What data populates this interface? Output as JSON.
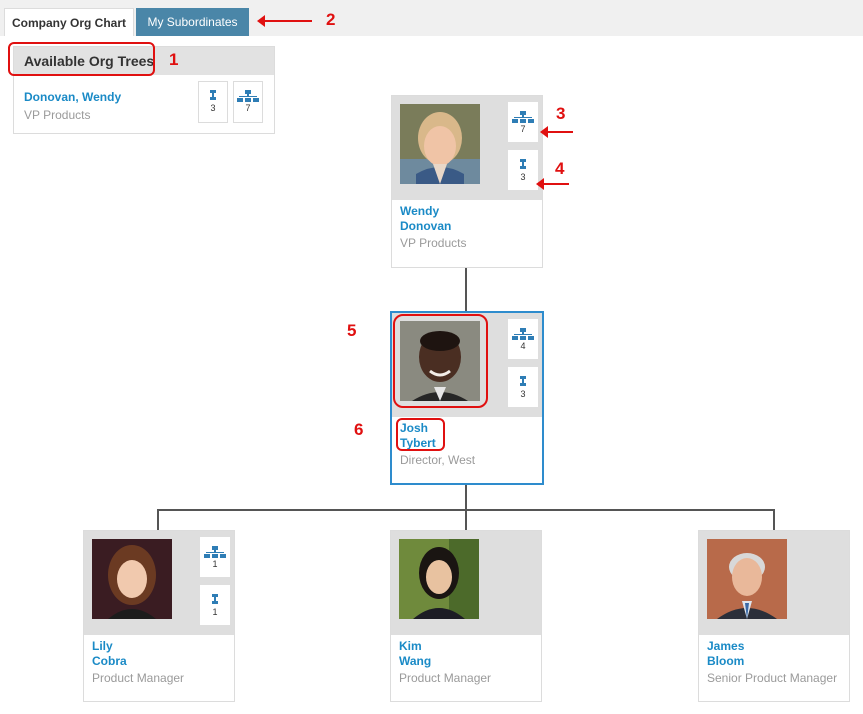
{
  "tabs": {
    "active": "Company Org Chart",
    "inactive": "My Subordinates"
  },
  "available": {
    "header": "Available Org Trees",
    "name": "Donovan, Wendy",
    "title": "VP Products",
    "direct_count": "3",
    "tree_count": "7"
  },
  "annotations": [
    "1",
    "2",
    "3",
    "4",
    "5",
    "6"
  ],
  "root": {
    "first": "Wendy",
    "last": "Donovan",
    "title": "VP Products",
    "tree_count": "7",
    "direct_count": "3"
  },
  "selected": {
    "first": "Josh",
    "last": "Tybert",
    "title": "Director, West",
    "tree_count": "4",
    "direct_count": "3"
  },
  "children": [
    {
      "first": "Lily",
      "last": "Cobra",
      "title": "Product Manager",
      "tree_count": "1",
      "direct_count": "1"
    },
    {
      "first": "Kim",
      "last": "Wang",
      "title": "Product Manager"
    },
    {
      "first": "James",
      "last": "Bloom",
      "title": "Senior Product Manager"
    }
  ],
  "colors": {
    "accent": "#1a8ac6",
    "tab_inactive": "#4a86a8",
    "annotation": "#e01010",
    "selected_border": "#2e8ccd"
  },
  "icons": [
    "tree-icon",
    "person-icon"
  ]
}
